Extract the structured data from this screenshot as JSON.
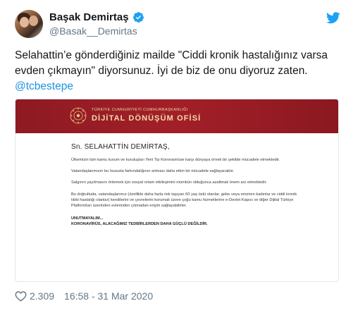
{
  "author": {
    "display_name": "Başak Demirtaş",
    "handle": "@Basak__Demirtas",
    "verified": true
  },
  "icons": {
    "verified": "verified-badge-icon",
    "brand": "twitter-bird-icon",
    "like": "heart-icon",
    "emblem": "turkish-presidency-emblem-icon"
  },
  "colors": {
    "link": "#1b95e0",
    "verified": "#1da1f2",
    "banner": "#9b1c24",
    "meta_text": "#657786"
  },
  "tweet": {
    "text": "Selahattin’e gönderdiğiniz mailde \"Ciddi kronik hastalığınız varsa evden çıkmayın\" diyorsunuz. İyi de biz de onu diyoruz zaten. ",
    "mention": "@tcbestepe"
  },
  "media": {
    "banner_small": "TÜRKİYE CUMHURİYETİ CUMHURBAŞKANLIĞI",
    "banner_big": "DİJİTAL DÖNÜŞÜM OFİSİ",
    "salutation": "Sn. SELAHATTİN DEMİRTAŞ,",
    "paragraphs": [
      "Ülkemizin tüm kamu kurum ve kuruluşları Yeni Tip Koronavirüse karşı dünyaya örnek bir şekilde mücadele etmektedir.",
      "Vatandaşlarımızın bu hususta farkındalığının artması daha etkin bir mücadele sağlayacaktır.",
      "Salgının yayılmasını önlemek için sosyal ortam etkileşimini mümkün olduğunca azaltmak önem arz etmektedir.",
      "Bu doğrultuda, vatandaşlarımız (özellikle daha fazla risk taşıyan 60 yaş üstü olanlar, gebe veya emziren kadınlar ve ciddi kronik tıbbi hastalığı olanlar) kendilerini ve çevrelerini korumak üzere çoğu kamu hizmetlerine e-Devlet Kapısı ve diğer Dijital Türkiye Platformları üzerinden evlerinden çıkmadan erişim sağlayabilirler."
    ],
    "closing_1": "UNUTMAYALIM...",
    "closing_2": "KORONAVİRÜS, ALACAĞIMIZ TEDBİRLERDEN DAHA GÜÇLÜ DEĞİLDİR."
  },
  "footer": {
    "like_count": "2.309",
    "timestamp": "16:58 - 31 Mar 2020"
  }
}
